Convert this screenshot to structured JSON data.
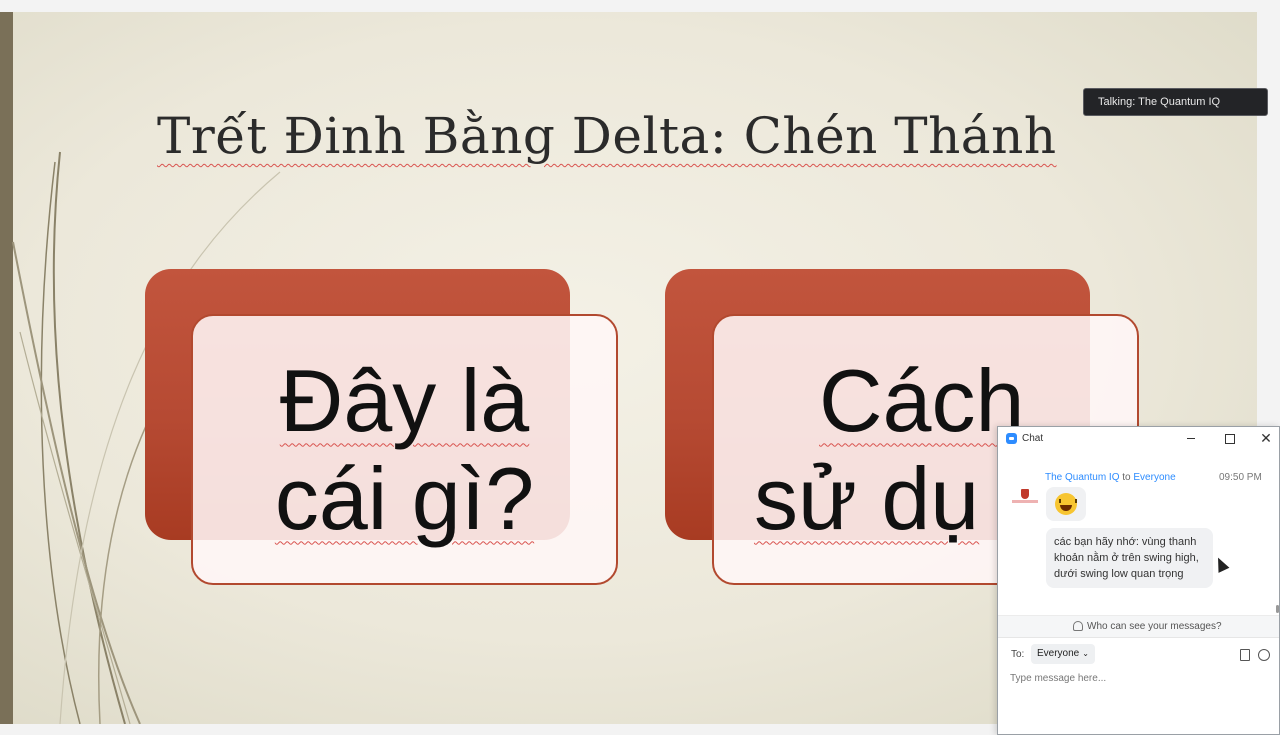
{
  "slide": {
    "title": "Trết Đinh Bằng Delta: Chén Thánh",
    "cards": [
      {
        "line1": "Đây là",
        "line2": "cái gì?"
      },
      {
        "line1": "Cách",
        "line2": "sử dụ"
      }
    ]
  },
  "talking_indicator": "Talking: The Quantum IQ",
  "chat": {
    "window_title": "Chat",
    "message": {
      "sender": "The Quantum IQ",
      "to_word": "to",
      "recipient": "Everyone",
      "time": "09:50 PM",
      "emoji": "grinning-squinting-face",
      "text": "các bạn hãy nhớ: vùng thanh khoản nằm ở trên swing high, dưới swing low quan trọng"
    },
    "privacy_link": "Who can see your messages?",
    "compose": {
      "to_label": "To:",
      "recipient_select": "Everyone",
      "placeholder": "Type message here..."
    }
  },
  "colors": {
    "card_back": "#b64a33",
    "card_border": "#b2492f",
    "link_blue": "#2d8cff",
    "talking_bg": "#232427"
  }
}
